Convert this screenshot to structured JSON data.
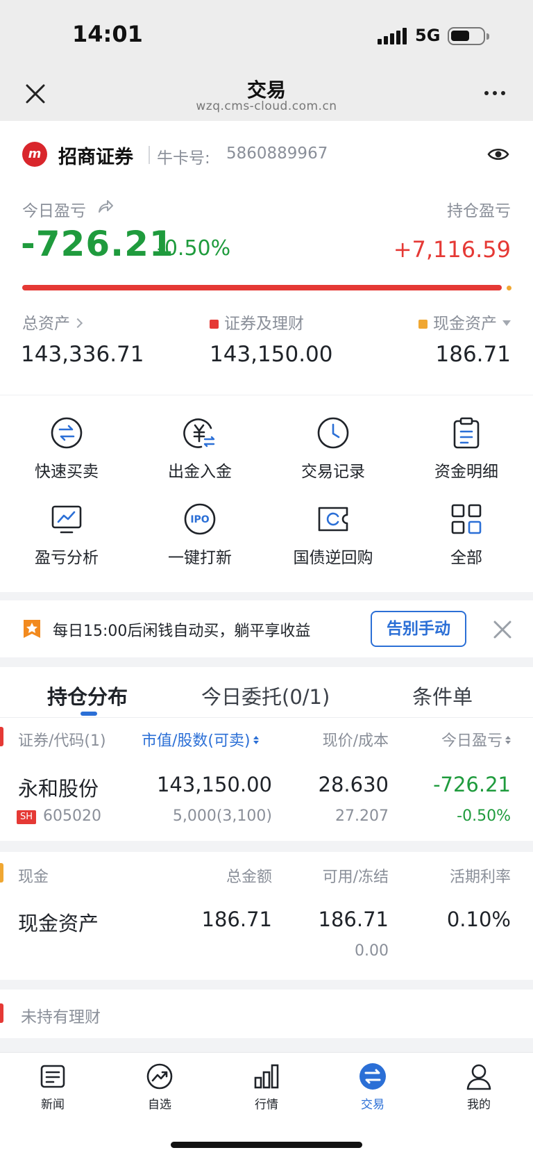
{
  "status_bar": {
    "time": "14:01",
    "network": "5G"
  },
  "browser": {
    "title": "交易",
    "url": "wzq.cms-cloud.com.cn"
  },
  "account": {
    "broker": "招商证券",
    "card_label": "牛卡号:",
    "card_number": "5860889967",
    "today_pnl_label": "今日盈亏",
    "today_pnl": "-726.21",
    "today_pnl_pct": "-0.50%",
    "holding_pnl_label": "持仓盈亏",
    "holding_pnl": "+7,116.59",
    "securities_share": 0.9987,
    "total_assets_label": "总资产",
    "total_assets": "143,336.71",
    "securities_label": "证券及理财",
    "securities_value": "143,150.00",
    "cash_label": "现金资产",
    "cash_value": "186.71"
  },
  "actions": [
    {
      "label": "快速买卖",
      "icon": "swap-icon"
    },
    {
      "label": "出金入金",
      "icon": "yuan-transfer-icon"
    },
    {
      "label": "交易记录",
      "icon": "clock-icon"
    },
    {
      "label": "资金明细",
      "icon": "clipboard-icon"
    },
    {
      "label": "盈亏分析",
      "icon": "monitor-chart-icon"
    },
    {
      "label": "一键打新",
      "icon": "ipo-icon"
    },
    {
      "label": "国债逆回购",
      "icon": "bond-repo-icon"
    },
    {
      "label": "全部",
      "icon": "grid-icon"
    }
  ],
  "banner": {
    "text": "每日15:00后闲钱自动买，躺平享收益",
    "button": "告别手动"
  },
  "tabs": [
    "持仓分布",
    "今日委托(0/1)",
    "条件单"
  ],
  "holdings": {
    "headers": [
      "证券/代码(1)",
      "市值/股数(可卖)",
      "现价/成本",
      "今日盈亏"
    ],
    "row": {
      "name": "永和股份",
      "market": "SH",
      "code": "605020",
      "market_value": "143,150.00",
      "shares": "5,000(3,100)",
      "price": "28.630",
      "cost": "27.207",
      "today_pnl": "-726.21",
      "today_pnl_pct": "-0.50%"
    }
  },
  "cash": {
    "headers": [
      "现金",
      "总金额",
      "可用/冻结",
      "活期利率"
    ],
    "row": {
      "name": "现金资产",
      "total": "186.71",
      "available": "186.71",
      "frozen": "0.00",
      "rate": "0.10%"
    }
  },
  "no_wealth": "未持有理财",
  "tabbar": [
    {
      "label": "新闻",
      "icon": "news-icon"
    },
    {
      "label": "自选",
      "icon": "trend-icon"
    },
    {
      "label": "行情",
      "icon": "bar-chart-icon"
    },
    {
      "label": "交易",
      "icon": "trade-icon"
    },
    {
      "label": "我的",
      "icon": "profile-icon"
    }
  ],
  "colors": {
    "green": "#1f9b3d",
    "red": "#e53935",
    "blue": "#2b6fd6",
    "orange": "#f0a732"
  }
}
